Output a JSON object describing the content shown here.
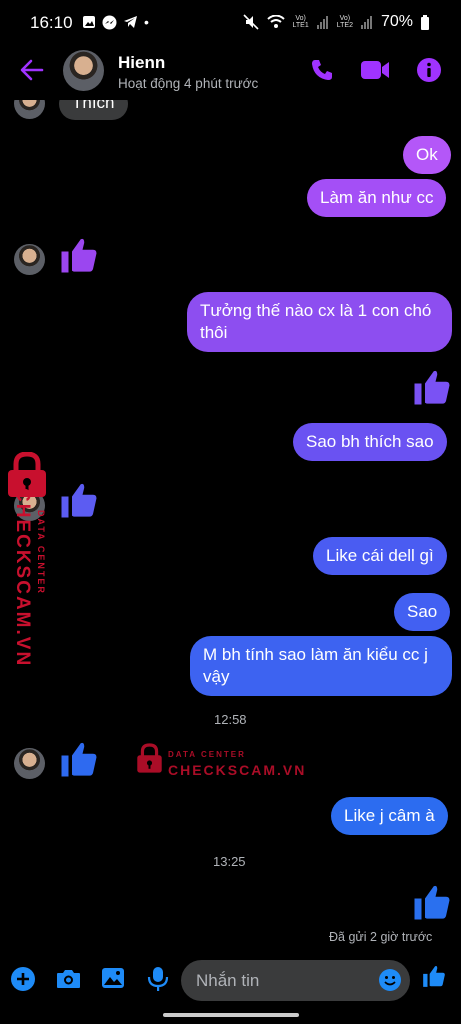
{
  "status_bar": {
    "time": "16:10",
    "lte1": "LTE1",
    "lte2": "LTE2",
    "volte": "Vo)",
    "battery": "70%"
  },
  "header": {
    "name": "Hienn",
    "status": "Hoạt động 4 phút trước"
  },
  "messages": {
    "top_partial": "Thích",
    "m1": "Ok",
    "m2": "Làm ăn như cc",
    "m3": "Tưởng thế nào cx là 1 con chó thôi",
    "m4": "Sao bh thích sao",
    "m5": "Like cái dell gì",
    "m6": "Sao",
    "m7": "M bh tính sao làm ăn kiểu cc j vậy",
    "m8": "Like j câm à"
  },
  "timestamps": {
    "t1": "12:58",
    "t2": "13:25"
  },
  "sent_status": "Đã gửi 2 giờ trước",
  "composer": {
    "placeholder": "Nhắn tin"
  },
  "watermark": {
    "brand": "CHECKSCAM.VN",
    "sub": "DATA CENTER"
  },
  "colors": {
    "accent": "#a033ff",
    "bubble_purple": "#8d4ef0",
    "bubble_blue": "#2e6af0",
    "icon_blue": "#1e8bf7",
    "watermark": "#c8102e"
  }
}
